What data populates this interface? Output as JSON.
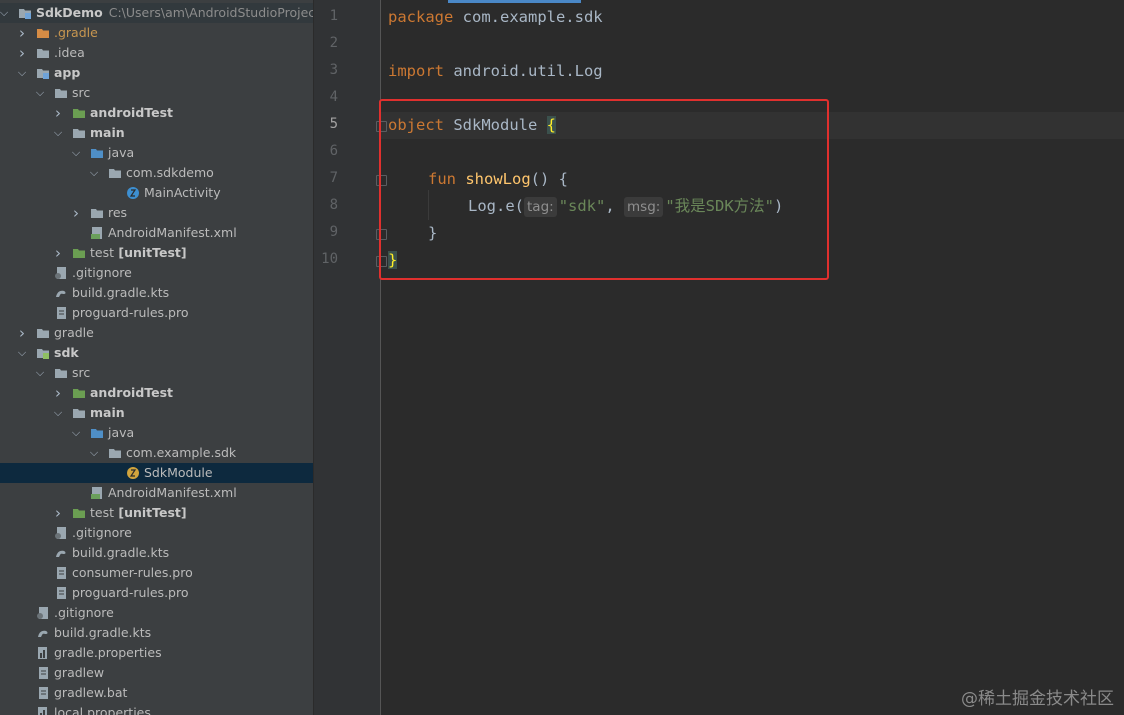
{
  "project": {
    "name": "SdkDemo",
    "path": "C:\\Users\\am\\AndroidStudioProjects\\",
    "tree": [
      {
        "label": "SdkDemo",
        "suffix": "C:\\Users\\am\\AndroidStudioProjects\\",
        "depth": 0,
        "arrow": "down",
        "icon": "module",
        "bold": true,
        "style": "root"
      },
      {
        "label": ".gradle",
        "depth": 1,
        "arrow": "right",
        "icon": "folder-orange",
        "style": "orange"
      },
      {
        "label": ".idea",
        "depth": 1,
        "arrow": "right",
        "icon": "folder"
      },
      {
        "label": "app",
        "depth": 1,
        "arrow": "down",
        "icon": "module",
        "bold": true
      },
      {
        "label": "src",
        "depth": 2,
        "arrow": "down",
        "icon": "folder"
      },
      {
        "label": "androidTest",
        "depth": 3,
        "arrow": "right",
        "icon": "folder-test",
        "bold": true
      },
      {
        "label": "main",
        "depth": 3,
        "arrow": "down",
        "icon": "folder-source",
        "bold": true
      },
      {
        "label": "java",
        "depth": 4,
        "arrow": "down",
        "icon": "folder-blue"
      },
      {
        "label": "com.sdkdemo",
        "depth": 5,
        "arrow": "down",
        "icon": "package"
      },
      {
        "label": "MainActivity",
        "depth": 6,
        "arrow": "none",
        "icon": "kotlin-class"
      },
      {
        "label": "res",
        "depth": 4,
        "arrow": "right",
        "icon": "folder-res"
      },
      {
        "label": "AndroidManifest.xml",
        "depth": 4,
        "arrow": "none",
        "icon": "manifest"
      },
      {
        "label": "test",
        "suffix_bold": "[unitTest]",
        "depth": 3,
        "arrow": "right",
        "icon": "folder-test"
      },
      {
        "label": ".gitignore",
        "depth": 2,
        "arrow": "none",
        "icon": "file-ignore"
      },
      {
        "label": "build.gradle.kts",
        "depth": 2,
        "arrow": "none",
        "icon": "gradle"
      },
      {
        "label": "proguard-rules.pro",
        "depth": 2,
        "arrow": "none",
        "icon": "file"
      },
      {
        "label": "gradle",
        "depth": 1,
        "arrow": "right",
        "icon": "folder"
      },
      {
        "label": "sdk",
        "depth": 1,
        "arrow": "down",
        "icon": "module-lib",
        "bold": true
      },
      {
        "label": "src",
        "depth": 2,
        "arrow": "down",
        "icon": "folder"
      },
      {
        "label": "androidTest",
        "depth": 3,
        "arrow": "right",
        "icon": "folder-test",
        "bold": true
      },
      {
        "label": "main",
        "depth": 3,
        "arrow": "down",
        "icon": "folder-source",
        "bold": true
      },
      {
        "label": "java",
        "depth": 4,
        "arrow": "down",
        "icon": "folder-blue"
      },
      {
        "label": "com.example.sdk",
        "depth": 5,
        "arrow": "down",
        "icon": "package"
      },
      {
        "label": "SdkModule",
        "depth": 6,
        "arrow": "none",
        "icon": "kotlin-object",
        "selected": true
      },
      {
        "label": "AndroidManifest.xml",
        "depth": 4,
        "arrow": "none",
        "icon": "manifest"
      },
      {
        "label": "test",
        "suffix_bold": "[unitTest]",
        "depth": 3,
        "arrow": "right",
        "icon": "folder-test"
      },
      {
        "label": ".gitignore",
        "depth": 2,
        "arrow": "none",
        "icon": "file-ignore"
      },
      {
        "label": "build.gradle.kts",
        "depth": 2,
        "arrow": "none",
        "icon": "gradle"
      },
      {
        "label": "consumer-rules.pro",
        "depth": 2,
        "arrow": "none",
        "icon": "file"
      },
      {
        "label": "proguard-rules.pro",
        "depth": 2,
        "arrow": "none",
        "icon": "file"
      },
      {
        "label": ".gitignore",
        "depth": 1,
        "arrow": "none",
        "icon": "file-ignore"
      },
      {
        "label": "build.gradle.kts",
        "depth": 1,
        "arrow": "none",
        "icon": "gradle"
      },
      {
        "label": "gradle.properties",
        "depth": 1,
        "arrow": "none",
        "icon": "properties"
      },
      {
        "label": "gradlew",
        "depth": 1,
        "arrow": "none",
        "icon": "file"
      },
      {
        "label": "gradlew.bat",
        "depth": 1,
        "arrow": "none",
        "icon": "file"
      },
      {
        "label": "local.properties",
        "depth": 1,
        "arrow": "none",
        "icon": "properties"
      }
    ]
  },
  "editor": {
    "line_numbers": [
      "1",
      "2",
      "3",
      "4",
      "5",
      "6",
      "7",
      "8",
      "9",
      "10"
    ],
    "current_line": "5",
    "code": {
      "l1_kw": "package",
      "l1_rest": " com.example.sdk",
      "l3_kw": "import",
      "l3_rest": " android.util.Log",
      "l5_kw": "object",
      "l5_name": " SdkModule ",
      "l5_brace": "{",
      "l7_kw": "fun",
      "l7_fn": " showLog",
      "l7_rest": "() {",
      "l8_call": "Log.e(",
      "l8_hint_tag": "tag:",
      "l8_str_tag": "\"sdk\"",
      "l8_comma": ", ",
      "l8_hint_msg": "msg:",
      "l8_str_msg": "\"我是SDK方法\"",
      "l8_close": ")",
      "l9": "}",
      "l10": "}"
    }
  },
  "watermark": "@稀土掘金技术社区",
  "colors": {
    "highlight_box": "#e0302e",
    "keyword": "#cc7832",
    "string": "#6a8759",
    "selection": "#0d293e"
  }
}
